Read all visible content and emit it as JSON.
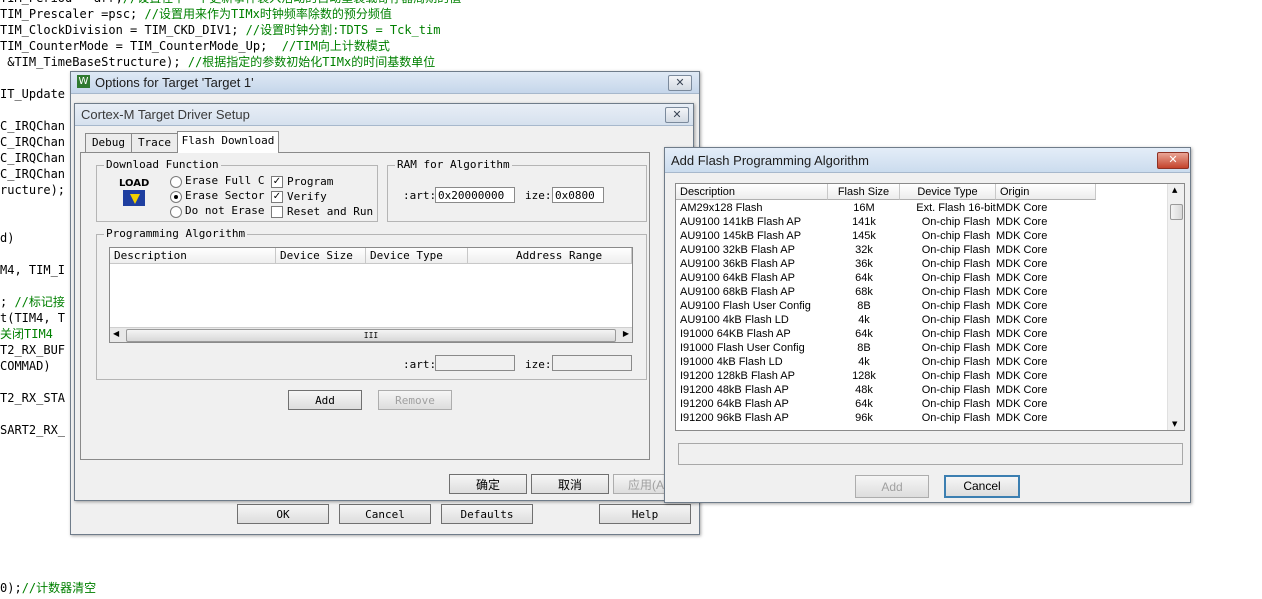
{
  "code_lines": [
    {
      "code": "TIM_Period = arr;",
      "comment": "//设置在下一个更新事件装入活动的自动重装载寄存器周期的值"
    },
    {
      "code": "TIM_Prescaler =psc; ",
      "comment": "//设置用来作为TIMx时钟频率除数的预分频值"
    },
    {
      "code": "TIM_ClockDivision = TIM_CKD_DIV1; ",
      "comment": "//设置时钟分割:TDTS = Tck_tim"
    },
    {
      "code": "TIM_CounterMode = TIM_CounterMode_Up;  ",
      "comment": "//TIM向上计数模式"
    },
    {
      "code": " &TIM_TimeBaseStructure); ",
      "comment": "//根据指定的参数初始化TIMx的时间基数单位"
    },
    {
      "code": "",
      "comment": ""
    },
    {
      "code": "IT_Update",
      "comment": ""
    },
    {
      "code": "",
      "comment": ""
    },
    {
      "code": "C_IRQChan",
      "comment": ""
    },
    {
      "code": "C_IRQChan",
      "comment": ""
    },
    {
      "code": "C_IRQChan",
      "comment": ""
    },
    {
      "code": "C_IRQChan",
      "comment": ""
    },
    {
      "code": "ructure);",
      "comment": ""
    },
    {
      "code": "",
      "comment": ""
    },
    {
      "code": "",
      "comment": ""
    },
    {
      "code": "d)",
      "comment": ""
    },
    {
      "code": "",
      "comment": ""
    },
    {
      "code": "M4, TIM_I",
      "comment": ""
    },
    {
      "code": "",
      "comment": ""
    },
    {
      "code": "; ",
      "comment": "//标记接"
    },
    {
      "code": "t(TIM4, T",
      "comment": ""
    },
    {
      "code": "",
      "comment": "关闭TIM4"
    },
    {
      "code": "T2_RX_BUF",
      "comment": ""
    },
    {
      "code": "COMMAD)",
      "comment": ""
    },
    {
      "code": "",
      "comment": ""
    },
    {
      "code": "T2_RX_STA",
      "comment": ""
    },
    {
      "code": "",
      "comment": ""
    },
    {
      "code": "SART2_RX_",
      "comment": ""
    },
    {
      "code": "",
      "comment": ""
    }
  ],
  "code_tail": {
    "code": "0);",
    "comment": "//计数器清空"
  },
  "options_dialog": {
    "title": "Options for Target 'Target 1'",
    "close": "✕",
    "buttons": {
      "ok": "OK",
      "cancel": "Cancel",
      "defaults": "Defaults",
      "help": "Help"
    }
  },
  "driver_dialog": {
    "title": "Cortex-M Target Driver Setup",
    "close": "✕",
    "tabs": [
      "Debug",
      "Trace",
      "Flash Download"
    ],
    "download_function": {
      "label": "Download Function",
      "load_icon_text": "LOAD",
      "erase_options": [
        "Erase Full C",
        "Erase Sector",
        "Do not Erase"
      ],
      "selected_erase": 1,
      "checks": [
        {
          "label": "Program",
          "checked": true
        },
        {
          "label": "Verify",
          "checked": true
        },
        {
          "label": "Reset and Run",
          "checked": false
        }
      ]
    },
    "ram": {
      "label": "RAM for Algorithm",
      "start_label": ":art:",
      "start_value": "0x20000000",
      "size_label": "ize:",
      "size_value": "0x0800"
    },
    "prog_algo": {
      "label": "Programming Algorithm",
      "columns": [
        "Description",
        "Device Size",
        "Device Type",
        "Address Range"
      ],
      "scroll_mark": "III",
      "start_label": ":art:",
      "size_label": "ize:"
    },
    "add_button": "Add",
    "remove_button": "Remove",
    "buttons": {
      "ok": "确定",
      "cancel": "取消",
      "apply": "应用(A"
    }
  },
  "flash_dialog": {
    "title": "Add Flash Programming Algorithm",
    "close": "✕",
    "columns": [
      "Description",
      "Flash Size",
      "Device Type",
      "Origin"
    ],
    "rows": [
      [
        "AM29x128 Flash",
        "16M",
        "Ext. Flash 16-bit",
        "MDK Core"
      ],
      [
        "AU9100 141kB Flash AP",
        "141k",
        "On-chip Flash",
        "MDK Core"
      ],
      [
        "AU9100 145kB Flash AP",
        "145k",
        "On-chip Flash",
        "MDK Core"
      ],
      [
        "AU9100 32kB Flash AP",
        "32k",
        "On-chip Flash",
        "MDK Core"
      ],
      [
        "AU9100 36kB Flash AP",
        "36k",
        "On-chip Flash",
        "MDK Core"
      ],
      [
        "AU9100 64kB Flash AP",
        "64k",
        "On-chip Flash",
        "MDK Core"
      ],
      [
        "AU9100 68kB Flash AP",
        "68k",
        "On-chip Flash",
        "MDK Core"
      ],
      [
        "AU9100 Flash User Config",
        "8B",
        "On-chip Flash",
        "MDK Core"
      ],
      [
        "AU9100 4kB Flash LD",
        "4k",
        "On-chip Flash",
        "MDK Core"
      ],
      [
        "I91000 64KB Flash AP",
        "64k",
        "On-chip Flash",
        "MDK Core"
      ],
      [
        "I91000 Flash User Config",
        "8B",
        "On-chip Flash",
        "MDK Core"
      ],
      [
        "I91000 4kB Flash LD",
        "4k",
        "On-chip Flash",
        "MDK Core"
      ],
      [
        "I91200 128kB Flash AP",
        "128k",
        "On-chip Flash",
        "MDK Core"
      ],
      [
        "I91200 48kB Flash AP",
        "48k",
        "On-chip Flash",
        "MDK Core"
      ],
      [
        "I91200 64kB Flash AP",
        "64k",
        "On-chip Flash",
        "MDK Core"
      ],
      [
        "I91200 96kB Flash AP",
        "96k",
        "On-chip Flash",
        "MDK Core"
      ]
    ],
    "add_button": "Add",
    "cancel_button": "Cancel"
  }
}
